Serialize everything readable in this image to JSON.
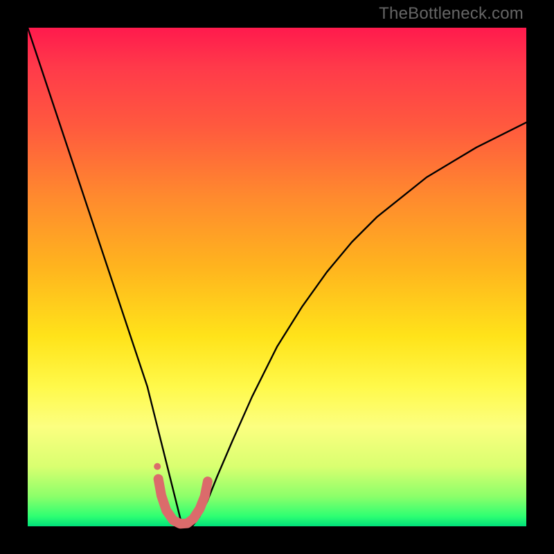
{
  "watermark": {
    "text": "TheBottleneck.com"
  },
  "chart_data": {
    "type": "line",
    "title": "",
    "xlabel": "",
    "ylabel": "",
    "xlim": [
      0,
      100
    ],
    "ylim": [
      0,
      100
    ],
    "grid": false,
    "legend": false,
    "background_gradient": {
      "stops": [
        {
          "pos": 0,
          "color": "#ff1a4d"
        },
        {
          "pos": 20,
          "color": "#ff5a3e"
        },
        {
          "pos": 48,
          "color": "#ffb41e"
        },
        {
          "pos": 72,
          "color": "#fff94a"
        },
        {
          "pos": 94,
          "color": "#8cff6a"
        },
        {
          "pos": 100,
          "color": "#00e07a"
        }
      ]
    },
    "series": [
      {
        "name": "bottleneck-curve",
        "stroke": "#000000",
        "x": [
          0,
          3,
          6,
          9,
          12,
          15,
          18,
          21,
          24,
          26,
          28,
          29.5,
          30.5,
          31,
          32,
          33,
          34.5,
          36,
          38,
          41,
          45,
          50,
          55,
          60,
          65,
          70,
          75,
          80,
          85,
          90,
          95,
          100
        ],
        "y": [
          100,
          91,
          82,
          73,
          64,
          55,
          46,
          37,
          28,
          20,
          12,
          6,
          2,
          0,
          0,
          0,
          2,
          5,
          10,
          17,
          26,
          36,
          44,
          51,
          57,
          62,
          66,
          70,
          73,
          76,
          78.5,
          81
        ]
      },
      {
        "name": "marker-arc",
        "stroke": "#db6b6b",
        "x": [
          26.2,
          26.8,
          27.8,
          29.2,
          30.6,
          32.0,
          33.2,
          34.5,
          35.5,
          36.1
        ],
        "y": [
          9.5,
          6.2,
          3.2,
          1.2,
          0.5,
          0.6,
          1.5,
          3.5,
          6.0,
          9.0
        ]
      },
      {
        "name": "marker-dot",
        "type": "scatter",
        "x": [
          26.0
        ],
        "y": [
          12.0
        ],
        "radius": 5,
        "fill": "#db6b6b"
      }
    ]
  }
}
